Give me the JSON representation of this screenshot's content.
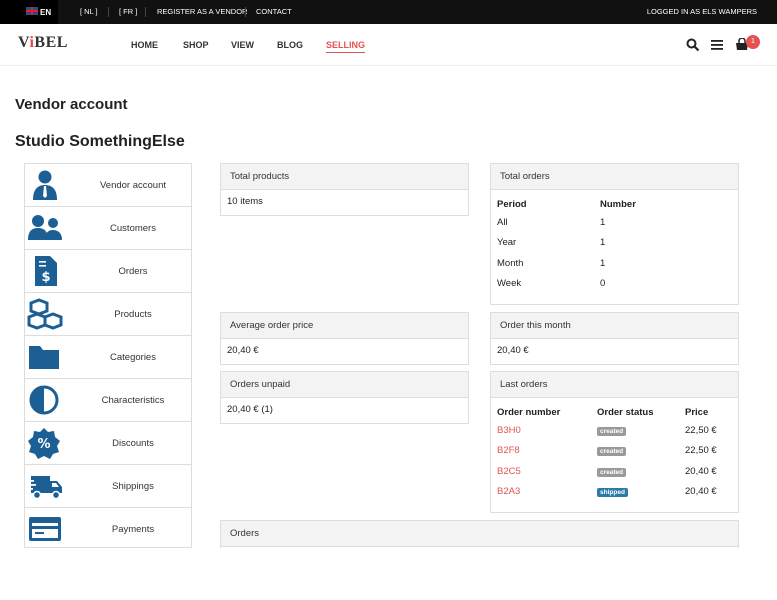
{
  "topbar": {
    "lang_current": "EN",
    "lang_nl": "[ NL ]",
    "lang_fr": "[ FR ]",
    "register": "REGISTER AS A VENDOR",
    "contact": "CONTACT",
    "login_status": "LOGGED IN AS ELS WAMPERS"
  },
  "header": {
    "logo": "ViBEL",
    "nav": [
      "HOME",
      "SHOP",
      "VIEW",
      "BLOG",
      "SELLING"
    ],
    "active_nav": "SELLING",
    "cart_count": "1"
  },
  "page": {
    "title": "Vendor account",
    "shop_name": "Studio SomethingElse"
  },
  "sidebar": {
    "items": [
      {
        "label": "Vendor account",
        "icon": "person-icon"
      },
      {
        "label": "Customers",
        "icon": "users-icon"
      },
      {
        "label": "Orders",
        "icon": "invoice-icon"
      },
      {
        "label": "Products",
        "icon": "boxes-icon"
      },
      {
        "label": "Categories",
        "icon": "folder-icon"
      },
      {
        "label": "Characteristics",
        "icon": "contrast-icon"
      },
      {
        "label": "Discounts",
        "icon": "percent-badge-icon"
      },
      {
        "label": "Shippings",
        "icon": "truck-icon"
      },
      {
        "label": "Payments",
        "icon": "credit-card-icon"
      }
    ],
    "icon_color": "#1c5f95"
  },
  "panels": {
    "total_products": {
      "title": "Total products",
      "value": "10 items"
    },
    "avg_order_price": {
      "title": "Average order price",
      "value": "20,40 €"
    },
    "orders_unpaid": {
      "title": "Orders unpaid",
      "value": "20,40 € (1)"
    },
    "orders": {
      "title": "Orders"
    },
    "order_this_month": {
      "title": "Order this month",
      "value": "20,40 €"
    },
    "total_orders": {
      "title": "Total orders",
      "col_period": "Period",
      "col_number": "Number",
      "rows": [
        {
          "period": "All",
          "number": "1"
        },
        {
          "period": "Year",
          "number": "1"
        },
        {
          "period": "Month",
          "number": "1"
        },
        {
          "period": "Week",
          "number": "0"
        }
      ]
    },
    "last_orders": {
      "title": "Last orders",
      "col_number": "Order number",
      "col_status": "Order status",
      "col_price": "Price",
      "rows": [
        {
          "number": "B3H0",
          "status": "created",
          "price": "22,50 €"
        },
        {
          "number": "B2F8",
          "status": "created",
          "price": "22,50 €"
        },
        {
          "number": "B2C5",
          "status": "created",
          "price": "20,40 €"
        },
        {
          "number": "B2A3",
          "status": "shipped",
          "price": "20,40 €"
        }
      ]
    }
  },
  "colors": {
    "accent": "#e35353",
    "topbar": "#111111",
    "panel_head": "#f3f3f3",
    "status_created": "#999999",
    "status_shipped": "#2c7aa8"
  }
}
